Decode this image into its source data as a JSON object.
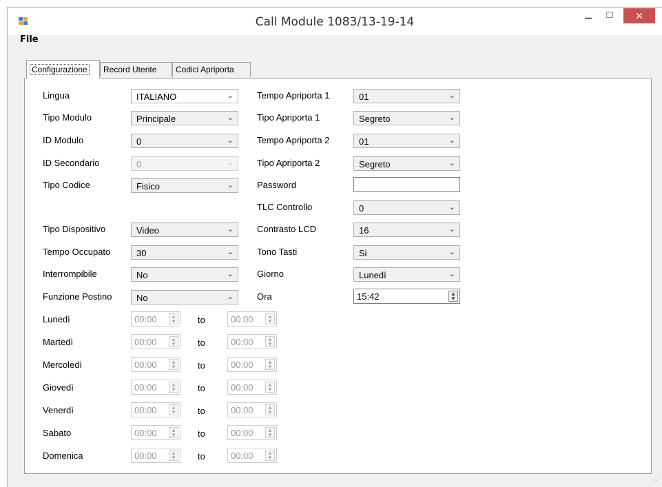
{
  "window": {
    "title": "Call Module 1083/13-19-14",
    "minimize": "–",
    "maximize": "□",
    "close": "✕"
  },
  "menu": {
    "file": "File"
  },
  "tabs": [
    {
      "label": "Configurazione",
      "active": true
    },
    {
      "label": "Record Utente",
      "active": false
    },
    {
      "label": "Codici Apriporta",
      "active": false
    }
  ],
  "left_fields": [
    {
      "label": "Lingua",
      "value": "ITALIANO"
    },
    {
      "label": "Tipo Modulo",
      "value": "Principale"
    },
    {
      "label": "ID Modulo",
      "value": "0"
    },
    {
      "label": "ID Secondario",
      "value": "0"
    },
    {
      "label": "Tipo Codice",
      "value": "Fisico"
    },
    {
      "label": "Tipo Dispositivo",
      "value": "Video"
    },
    {
      "label": "Tempo Occupato",
      "value": "30"
    },
    {
      "label": "Interrompibile",
      "value": "No"
    },
    {
      "label": "Funzione Postino",
      "value": "No"
    }
  ],
  "right_fields": [
    {
      "label": "Tempo Apriporta 1",
      "value": "01"
    },
    {
      "label": "Tipo Apriporta 1",
      "value": "Segreto"
    },
    {
      "label": "Tempo Apriporta 2",
      "value": "01"
    },
    {
      "label": "Tipo Apriporta 2",
      "value": "Segreto"
    },
    {
      "label": "Password",
      "value": ""
    },
    {
      "label": "TLC Controllo",
      "value": "0"
    },
    {
      "label": "Contrasto LCD",
      "value": "16"
    },
    {
      "label": "Tono Tasti",
      "value": "Si"
    },
    {
      "label": "Giorno",
      "value": "Lunedì"
    },
    {
      "label": "Ora",
      "value": "15:42"
    }
  ],
  "schedule": {
    "to_label": "to",
    "days": [
      {
        "day": "Lunedì",
        "from": "00:00",
        "to": "00:00"
      },
      {
        "day": "Martedì",
        "from": "00:00",
        "to": "00:00"
      },
      {
        "day": "Mercoledì",
        "from": "00:00",
        "to": "00:00"
      },
      {
        "day": "Giovedì",
        "from": "00:00",
        "to": "00:00"
      },
      {
        "day": "Venerdì",
        "from": "00:00",
        "to": "00:00"
      },
      {
        "day": "Sabato",
        "from": "00:00",
        "to": "00:00"
      },
      {
        "day": "Domenica",
        "from": "00:00",
        "to": "00:00"
      }
    ]
  },
  "icons": {
    "arrow": "⌄",
    "spin": "▲▼"
  }
}
